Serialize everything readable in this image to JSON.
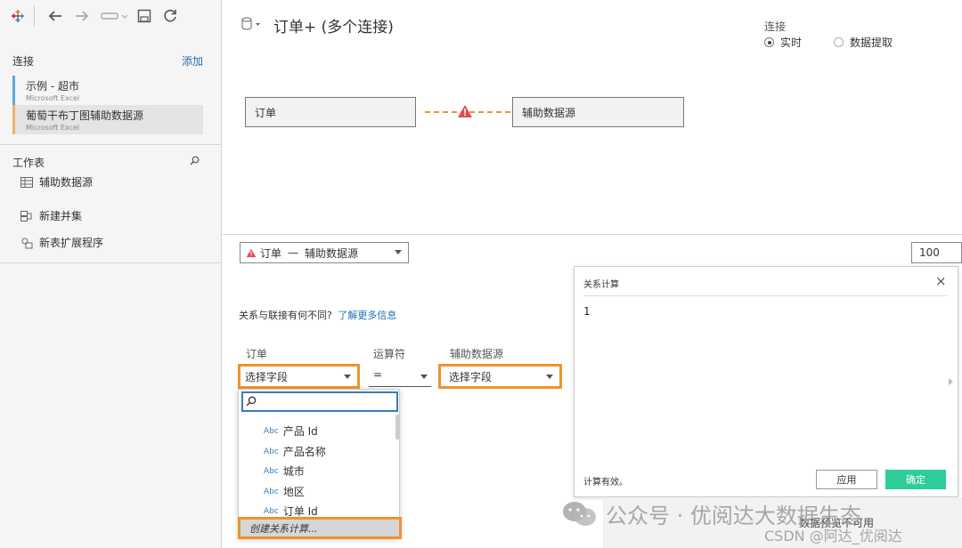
{
  "sidebar": {
    "connections_header": "连接",
    "add_label": "添加",
    "connections": [
      {
        "name": "示例 - 超市",
        "type": "Microsoft Excel"
      },
      {
        "name": "葡萄干布丁图辅助数据源",
        "type": "Microsoft Excel"
      }
    ],
    "worksheet_header": "工作表",
    "worksheet_items": [
      {
        "label": "辅助数据源"
      },
      {
        "label": "新建并集"
      },
      {
        "label": "新表扩展程序"
      }
    ]
  },
  "datasource": {
    "title": "订单+ (多个连接)",
    "connection_label": "连接",
    "options": [
      "实时",
      "数据提取"
    ],
    "selected": "实时"
  },
  "canvas": {
    "left_table": "订单",
    "right_table": "辅助数据源"
  },
  "relationship": {
    "selector_left": "订单",
    "selector_sep": "—",
    "selector_right": "辅助数据源",
    "rows_value": "100",
    "help_text": "关系与联接有何不同?",
    "help_link": "了解更多信息",
    "col_left": "订单",
    "col_op": "运算符",
    "col_right": "辅助数据源",
    "left_placeholder": "选择字段",
    "operator": "=",
    "right_placeholder": "选择字段"
  },
  "fieldlist": {
    "search_placeholder": "",
    "type_label": "Abc",
    "fields": [
      "产品 Id",
      "产品名称",
      "城市",
      "地区",
      "订单 Id"
    ],
    "create_calc": "创建关系计算..."
  },
  "calc_dialog": {
    "title": "关系计算",
    "expression": "1",
    "status": "计算有效。",
    "apply_label": "应用",
    "ok_label": "确定"
  },
  "footer": {
    "preview_text": "数据预览不可用",
    "watermark_main": "公众号 · 优阅达大数据生态",
    "watermark_sub": "CSDN @阿达_优阅达"
  },
  "colors": {
    "accent_orange": "#f0932b",
    "link_blue": "#1f6fb2",
    "ok_green": "#2ecc9a",
    "warning_red": "#e04a4a"
  }
}
